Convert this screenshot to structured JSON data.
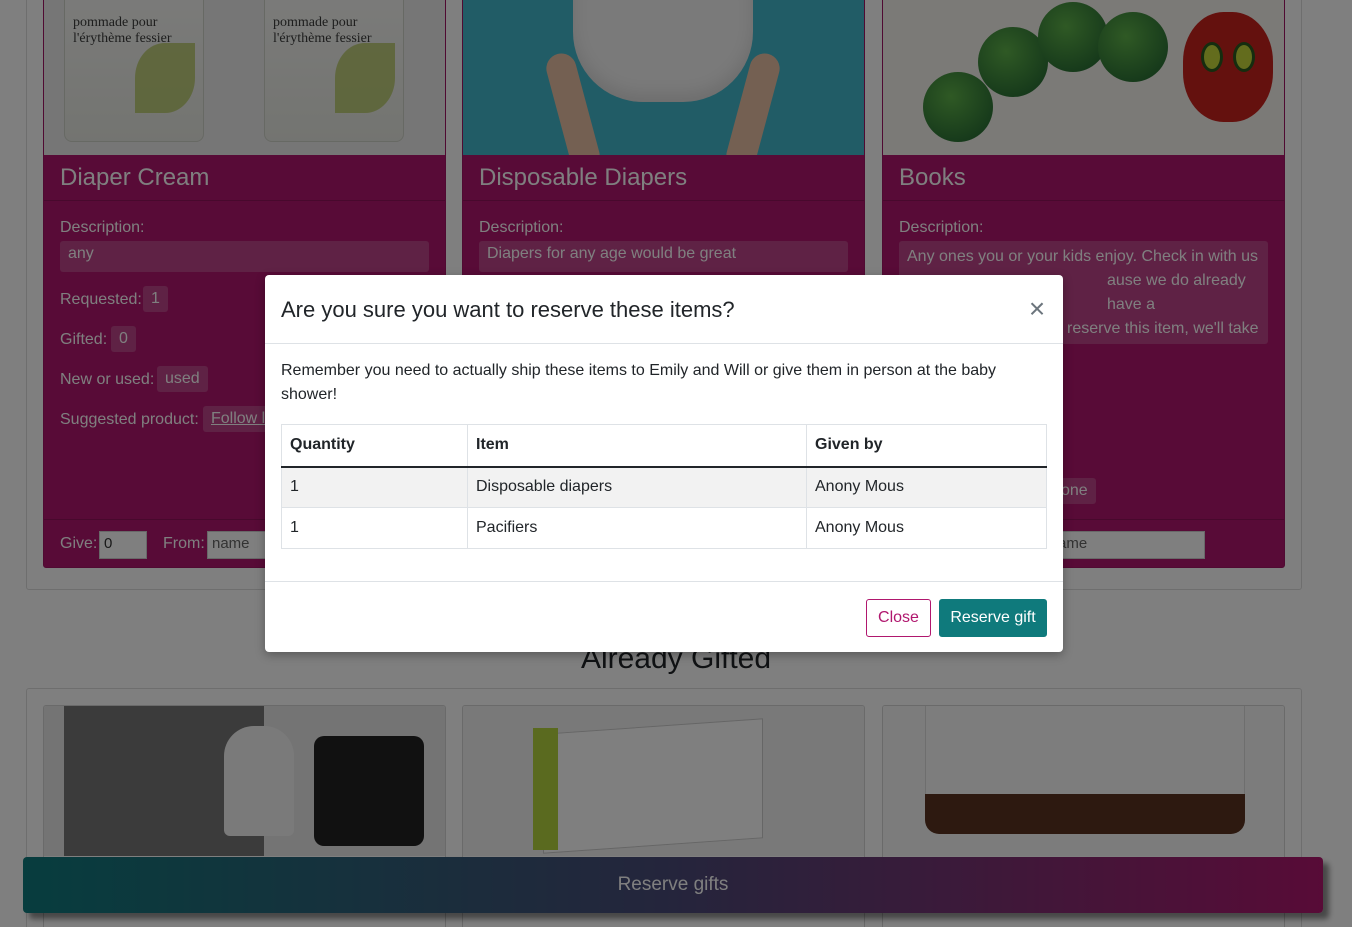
{
  "cards": [
    {
      "title": "Diaper Cream",
      "description_label": "Description:",
      "description": "any",
      "requested_label": "Requested:",
      "requested": "1",
      "gifted_label": "Gifted:",
      "gifted": "0",
      "new_used_label": "New or used:",
      "new_used": "used",
      "suggested_label": "Suggested product:",
      "suggested_link": "Follow l",
      "give_label": "Give:",
      "give_value": "0",
      "from_label": "From:",
      "from_placeholder": "name",
      "image_text": "pommade pour l'érythème fessier"
    },
    {
      "title": "Disposable Diapers",
      "description_label": "Description:",
      "description": "Diapers for any age would be great"
    },
    {
      "title": "Books",
      "description_label": "Description:",
      "description": "Any ones you or your kids enjoy. Check in with us",
      "description_line2": "ause we do already have a",
      "description_line3": "reserve this item, we'll take",
      "partial_badge": "one",
      "from_placeholder": "ame"
    }
  ],
  "gifted_heading": "Already Gifted",
  "reserve_bar_label": "Reserve gifts",
  "modal": {
    "title": "Are you sure you want to reserve these items?",
    "close_icon": "×",
    "message": "Remember you need to actually ship these items to Emily and Will or give them in person at the baby shower!",
    "table": {
      "headers": [
        "Quantity",
        "Item",
        "Given by"
      ],
      "rows": [
        [
          "1",
          "Disposable diapers",
          "Anony Mous"
        ],
        [
          "1",
          "Pacifiers",
          "Anony Mous"
        ]
      ]
    },
    "close_button": "Close",
    "reserve_button": "Reserve gift"
  },
  "colors": {
    "card": "#b0176e",
    "primary": "#0f7a7c",
    "accent": "#b0176e"
  }
}
